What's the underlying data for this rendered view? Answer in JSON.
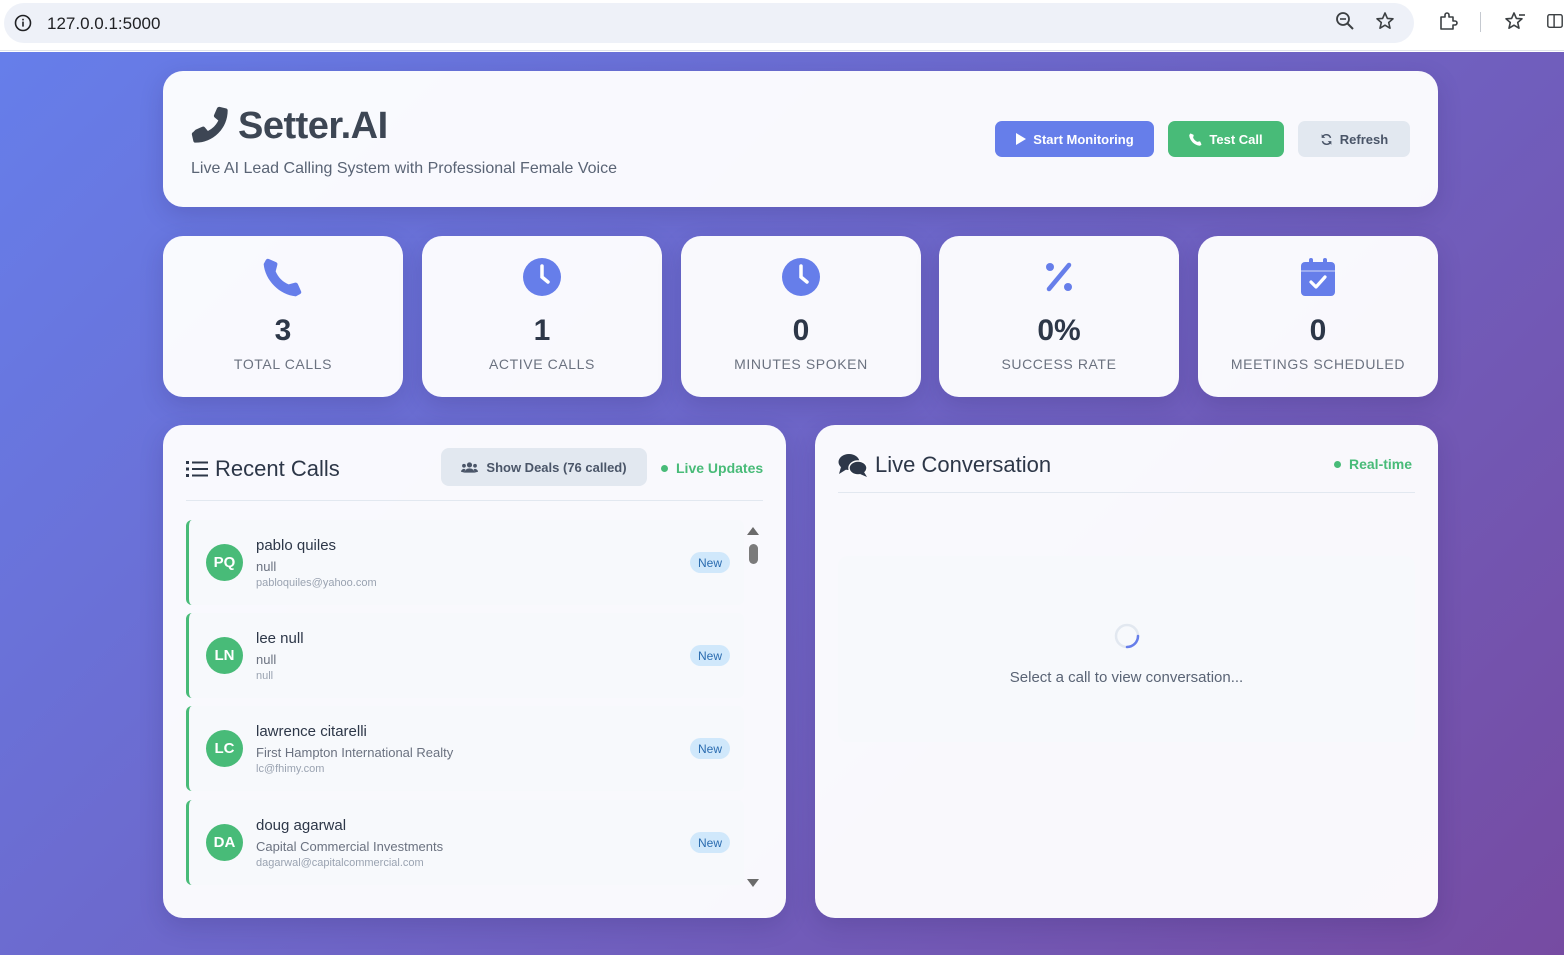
{
  "browser": {
    "url": "127.0.0.1:5000",
    "icons": [
      "info-icon",
      "zoom-icon",
      "bookmark-star-icon",
      "extensions-icon",
      "favorites-icon",
      "split-screen-icon"
    ]
  },
  "colors": {
    "primary": "#667eea",
    "success": "#48bb78",
    "neutral": "#e2e8f0",
    "gradient_start": "#667eea",
    "gradient_end": "#764ba2"
  },
  "header": {
    "title": "Setter.AI",
    "subtitle": "Live AI Lead Calling System with Professional Female Voice",
    "buttons": {
      "start_monitoring": "Start Monitoring",
      "test_call": "Test Call",
      "refresh": "Refresh"
    }
  },
  "stats": [
    {
      "icon": "phone-icon",
      "value": "3",
      "label": "TOTAL CALLS"
    },
    {
      "icon": "clock-icon",
      "value": "1",
      "label": "ACTIVE CALLS"
    },
    {
      "icon": "clock-icon",
      "value": "0",
      "label": "MINUTES SPOKEN"
    },
    {
      "icon": "percent-icon",
      "value": "0%",
      "label": "SUCCESS RATE"
    },
    {
      "icon": "calendar-check-icon",
      "value": "0",
      "label": "MEETINGS SCHEDULED"
    }
  ],
  "recent_calls": {
    "title": "Recent Calls",
    "show_deals": "Show Deals (76 called)",
    "live_updates": "Live Updates",
    "items": [
      {
        "initials": "PQ",
        "name": "pablo quiles",
        "company": "null",
        "email": "pabloquiles@yahoo.com",
        "status": "New"
      },
      {
        "initials": "LN",
        "name": "lee null",
        "company": "null",
        "email": "null",
        "status": "New"
      },
      {
        "initials": "LC",
        "name": "lawrence citarelli",
        "company": "First Hampton International Realty",
        "email": "lc@fhimy.com",
        "status": "New"
      },
      {
        "initials": "DA",
        "name": "doug agarwal",
        "company": "Capital Commercial Investments",
        "email": "dagarwal@capitalcommercial.com",
        "status": "New"
      }
    ]
  },
  "conversation": {
    "title": "Live Conversation",
    "realtime": "Real-time",
    "empty_message": "Select a call to view conversation..."
  }
}
